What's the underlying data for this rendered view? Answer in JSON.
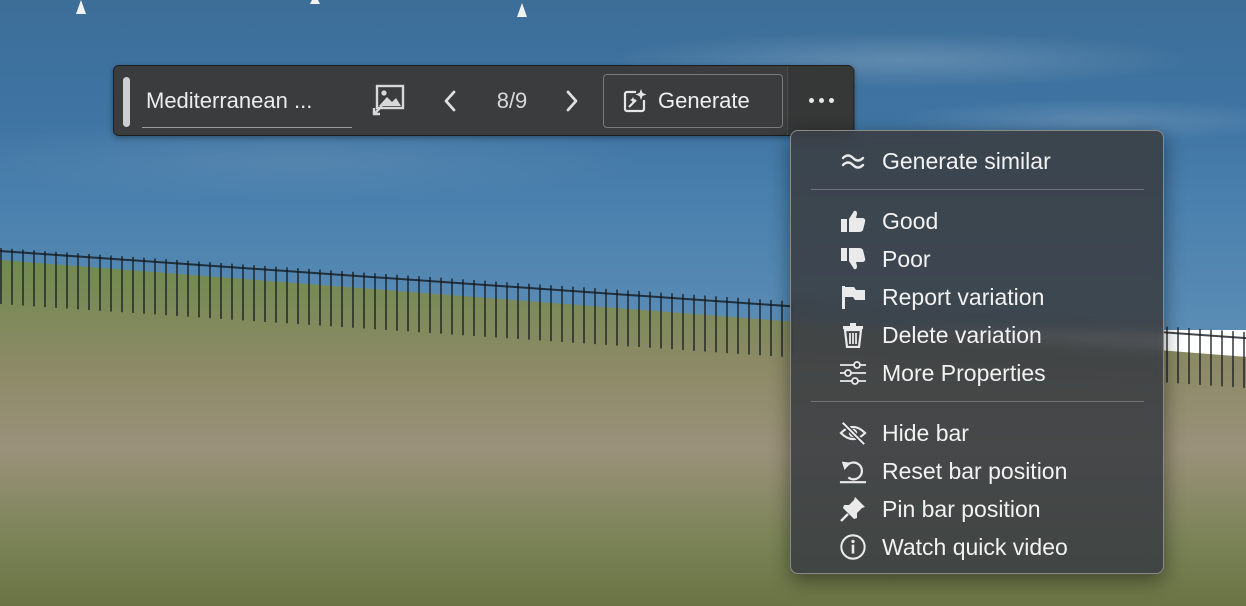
{
  "toolbar": {
    "prompt_text": "Mediterranean ...",
    "counter": "8/9",
    "generate_label": "Generate"
  },
  "menu": {
    "group1": [
      {
        "label": "Generate similar",
        "icon": "approx-icon"
      }
    ],
    "group2": [
      {
        "label": "Good",
        "icon": "thumbs-up-icon"
      },
      {
        "label": "Poor",
        "icon": "thumbs-down-icon"
      },
      {
        "label": "Report variation",
        "icon": "flag-icon"
      },
      {
        "label": "Delete variation",
        "icon": "trash-icon"
      },
      {
        "label": "More Properties",
        "icon": "sliders-icon"
      }
    ],
    "group3": [
      {
        "label": "Hide bar",
        "icon": "eye-slash-icon"
      },
      {
        "label": "Reset bar position",
        "icon": "reset-icon"
      },
      {
        "label": "Pin bar position",
        "icon": "pin-icon"
      },
      {
        "label": "Watch quick video",
        "icon": "info-icon"
      }
    ]
  }
}
